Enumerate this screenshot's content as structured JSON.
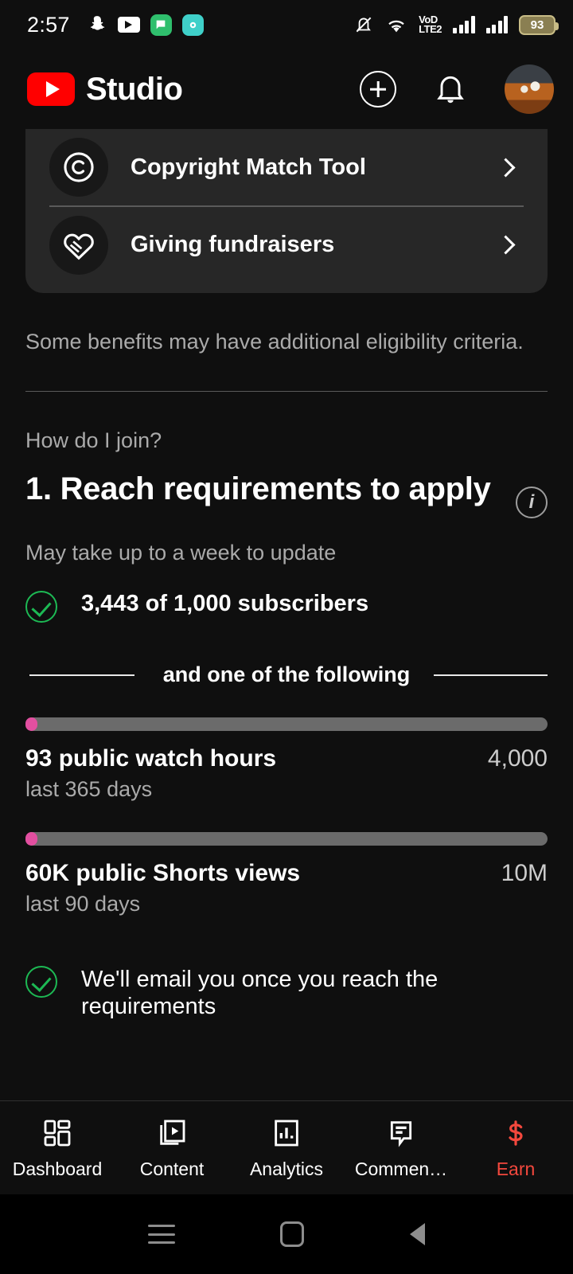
{
  "status_bar": {
    "time": "2:57",
    "left_icons": [
      "snapchat-icon",
      "youtube-icon",
      "messages-icon",
      "app-icon"
    ],
    "network_label_top": "VoD",
    "network_label_bottom": "LTE2",
    "battery_percent": "93",
    "right_icons": [
      "bell-off-icon",
      "wifi-icon",
      "volte-icon",
      "signal-1-icon",
      "signal-2-icon",
      "battery-icon"
    ]
  },
  "app_bar": {
    "brand": "Studio",
    "create_label": "create",
    "notifications_label": "notifications",
    "avatar_label": "account"
  },
  "benefits_card": {
    "items": [
      {
        "icon": "copyright-icon",
        "label": "Copyright Match Tool"
      },
      {
        "icon": "giving-heart-icon",
        "label": "Giving fundraisers"
      }
    ]
  },
  "eligibility_note": "Some benefits may have additional eligibility criteria.",
  "join": {
    "question": "How do I join?",
    "step_title": "1. Reach requirements to apply",
    "info_glyph": "i",
    "update_note": "May take up to a week to update",
    "subscriber_requirement": "3,443 of 1,000 subscribers",
    "divider_text": "and one of the following",
    "email_note": "We'll email you once you reach the requirements"
  },
  "metrics": [
    {
      "name": "93 public watch hours",
      "goal": "4,000",
      "period": "last 365 days",
      "progress_percent": 2.3,
      "fill_color": "#e24fa0",
      "track_color": "#6b6b6b"
    },
    {
      "name": "60K public Shorts views",
      "goal": "10M",
      "period": "last 90 days",
      "progress_percent": 2.3,
      "fill_color": "#e24fa0",
      "track_color": "#6b6b6b"
    }
  ],
  "bottom_nav": {
    "active_color": "#f4483d",
    "items": [
      {
        "label": "Dashboard",
        "icon": "dashboard-grid-icon",
        "active": false
      },
      {
        "label": "Content",
        "icon": "content-video-icon",
        "active": false
      },
      {
        "label": "Analytics",
        "icon": "analytics-bars-icon",
        "active": false
      },
      {
        "label": "Commen…",
        "icon": "comments-bubble-icon",
        "active": false
      },
      {
        "label": "Earn",
        "icon": "earn-dollar-icon",
        "active": true
      }
    ]
  },
  "system_nav": {
    "recents_label": "recents",
    "home_label": "home",
    "back_label": "back"
  }
}
